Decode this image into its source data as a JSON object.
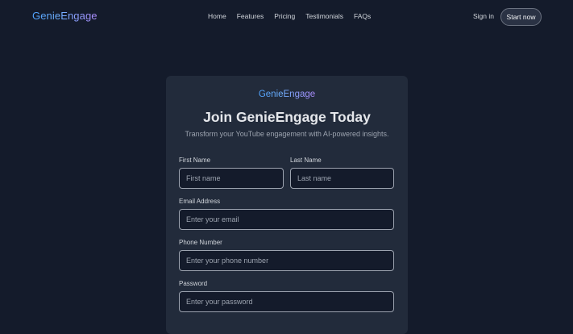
{
  "brand": "GenieEngage",
  "nav": {
    "links": [
      "Home",
      "Features",
      "Pricing",
      "Testimonials",
      "FAQs"
    ],
    "signin": "Sign in",
    "start": "Start now"
  },
  "card": {
    "logo": "GenieEngage",
    "title": "Join GenieEngage Today",
    "subtitle": "Transform your YouTube engagement with AI-powered insights."
  },
  "form": {
    "first_name": {
      "label": "First Name",
      "placeholder": "First name"
    },
    "last_name": {
      "label": "Last Name",
      "placeholder": "Last name"
    },
    "email": {
      "label": "Email Address",
      "placeholder": "Enter your email"
    },
    "phone": {
      "label": "Phone Number",
      "placeholder": "Enter your phone number"
    },
    "password": {
      "label": "Password",
      "placeholder": "Enter your password"
    }
  }
}
